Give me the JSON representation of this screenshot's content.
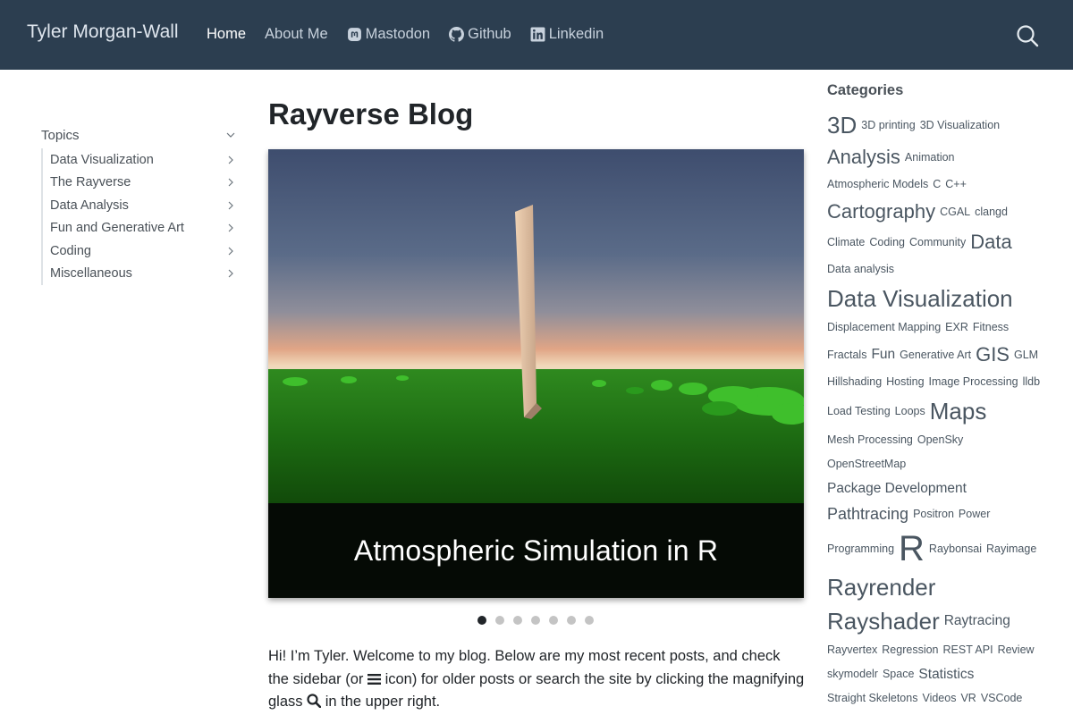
{
  "navbar": {
    "brand": "Tyler Morgan-Wall",
    "links": [
      {
        "label": "Home",
        "active": true
      },
      {
        "label": "About Me"
      },
      {
        "label": "Mastodon",
        "icon": "mastodon-icon"
      },
      {
        "label": "Github",
        "icon": "github-icon"
      },
      {
        "label": "Linkedin",
        "icon": "linkedin-icon"
      }
    ],
    "search_icon": "search-icon"
  },
  "sidebar": {
    "header": "Topics",
    "items": [
      {
        "label": "Data Visualization"
      },
      {
        "label": "The Rayverse"
      },
      {
        "label": "Data Analysis"
      },
      {
        "label": "Fun and Generative Art"
      },
      {
        "label": "Coding"
      },
      {
        "label": "Miscellaneous"
      }
    ]
  },
  "main": {
    "title": "Rayverse Blog",
    "carousel": {
      "caption": "Atmospheric Simulation in R",
      "slide_count": 7,
      "active_index": 0
    },
    "intro": {
      "part1": "Hi! I’m Tyler. Welcome to my blog. Below are my most recent posts, and check the sidebar (or ",
      "part2": " icon) for older posts or search the site by clicking the magnifying glass ",
      "part3": " in the upper right."
    }
  },
  "categories": {
    "title": "Categories",
    "lines": [
      [
        {
          "t": "3D",
          "s": 5
        },
        {
          "t": "3D printing",
          "s": 1
        },
        {
          "t": "3D Visualization",
          "s": 1
        }
      ],
      [
        {
          "t": "Analysis",
          "s": 4
        },
        {
          "t": "Animation",
          "s": 1
        }
      ],
      [
        {
          "t": "Atmospheric Models",
          "s": 1
        },
        {
          "t": "C",
          "s": 1
        },
        {
          "t": "C++",
          "s": 1
        }
      ],
      [
        {
          "t": "Cartography",
          "s": 4
        },
        {
          "t": "CGAL",
          "s": 1
        },
        {
          "t": "clangd",
          "s": 1
        }
      ],
      [
        {
          "t": "Climate",
          "s": 1
        },
        {
          "t": "Coding",
          "s": 1
        },
        {
          "t": "Community",
          "s": 1
        },
        {
          "t": "Data",
          "s": 4
        }
      ],
      [
        {
          "t": "Data analysis",
          "s": 1
        }
      ],
      [
        {
          "t": "Data Visualization",
          "s": 5
        }
      ],
      [
        {
          "t": "Displacement Mapping",
          "s": 1
        },
        {
          "t": "EXR",
          "s": 1
        },
        {
          "t": "Fitness",
          "s": 1
        }
      ],
      [
        {
          "t": "Fractals",
          "s": 1
        },
        {
          "t": "Fun",
          "s": 2
        },
        {
          "t": "Generative Art",
          "s": 1
        },
        {
          "t": "GIS",
          "s": 4
        },
        {
          "t": "GLM",
          "s": 1
        }
      ],
      [
        {
          "t": "Hillshading",
          "s": 1
        },
        {
          "t": "Hosting",
          "s": 1
        },
        {
          "t": "Image Processing",
          "s": 1
        },
        {
          "t": "lldb",
          "s": 1
        }
      ],
      [
        {
          "t": "Load Testing",
          "s": 1
        },
        {
          "t": "Loops",
          "s": 1
        },
        {
          "t": "Maps",
          "s": 5
        }
      ],
      [
        {
          "t": "Mesh Processing",
          "s": 1
        },
        {
          "t": "OpenSky",
          "s": 1
        }
      ],
      [
        {
          "t": "OpenStreetMap",
          "s": 1
        }
      ],
      [
        {
          "t": "Package Development",
          "s": 2
        }
      ],
      [
        {
          "t": "Pathtracing",
          "s": 3
        },
        {
          "t": "Positron",
          "s": 1
        },
        {
          "t": "Power",
          "s": 1
        }
      ],
      [
        {
          "t": "Programming",
          "s": 1
        },
        {
          "t": "R",
          "s": 6
        },
        {
          "t": "Raybonsai",
          "s": 1
        },
        {
          "t": "Rayimage",
          "s": 1
        }
      ],
      [
        {
          "t": "Rayrender",
          "s": 5
        }
      ],
      [
        {
          "t": "Rayshader",
          "s": 5
        },
        {
          "t": "Raytracing",
          "s": 2
        }
      ],
      [
        {
          "t": "Rayvertex",
          "s": 1
        },
        {
          "t": "Regression",
          "s": 1
        },
        {
          "t": "REST API",
          "s": 1
        },
        {
          "t": "Review",
          "s": 1
        }
      ],
      [
        {
          "t": "skymodelr",
          "s": 1
        },
        {
          "t": "Space",
          "s": 1
        },
        {
          "t": "Statistics",
          "s": 2
        }
      ],
      [
        {
          "t": "Straight Skeletons",
          "s": 1
        },
        {
          "t": "Videos",
          "s": 1
        },
        {
          "t": "VR",
          "s": 1
        },
        {
          "t": "VSCode",
          "s": 1
        }
      ]
    ]
  }
}
